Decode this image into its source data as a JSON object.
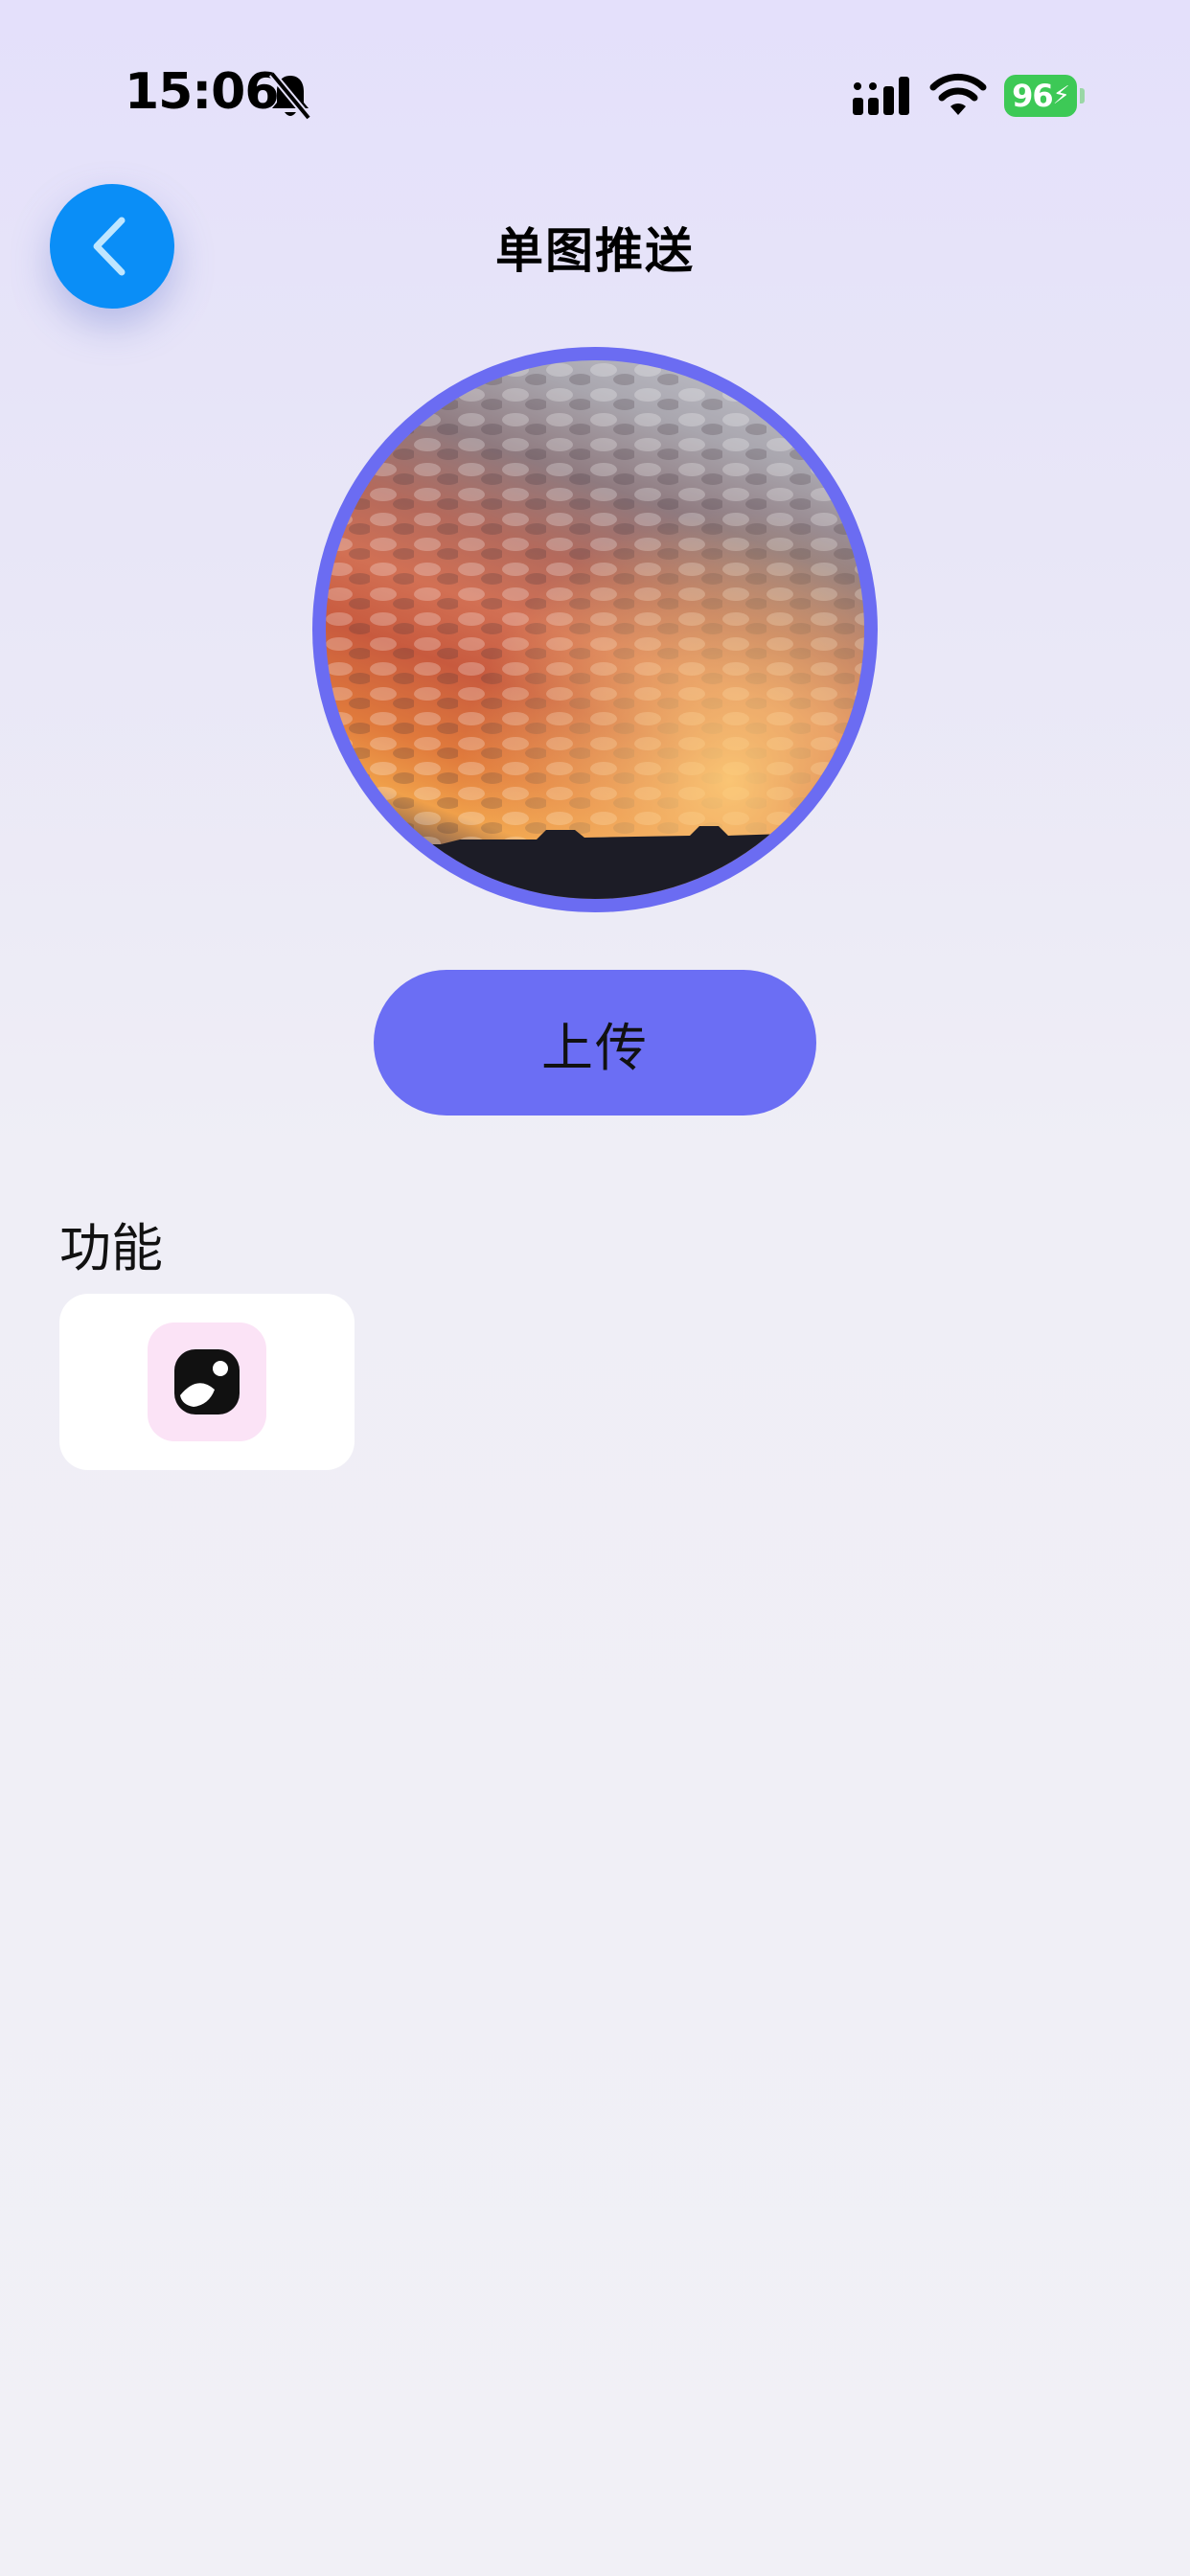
{
  "status_bar": {
    "time": "15:06",
    "battery": "96",
    "icons": [
      "bell-slash-icon",
      "cellular-signal-icon",
      "wifi-icon",
      "battery-charging-icon"
    ]
  },
  "header": {
    "title": "单图推送",
    "back_icon": "chevron-left-icon"
  },
  "photo": {
    "description_icon": "sunset-clouds-photo"
  },
  "upload_button": {
    "label": "上传"
  },
  "features": {
    "title": "功能",
    "items": [
      {
        "icon": "camera-icon"
      }
    ]
  },
  "colors": {
    "accent": "#6b6ef4",
    "back_button": "#0a8ef7",
    "battery": "#3dc956",
    "feature_icon_bg": "#fbe3f6"
  }
}
